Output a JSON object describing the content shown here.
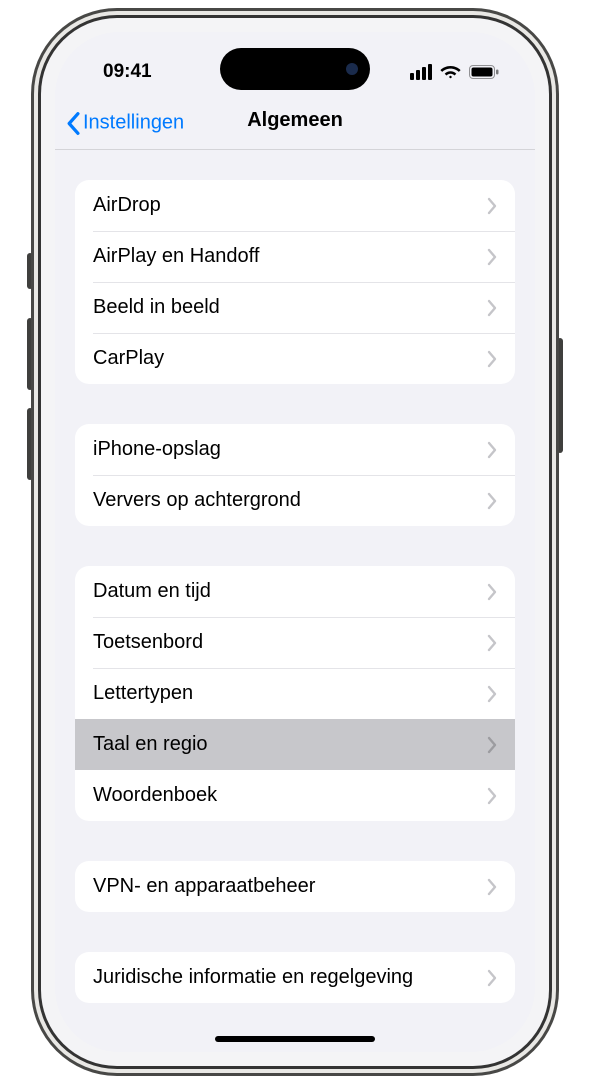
{
  "statusBar": {
    "time": "09:41"
  },
  "nav": {
    "back": "Instellingen",
    "title": "Algemeen"
  },
  "groups": [
    {
      "rows": [
        {
          "key": "airdrop",
          "label": "AirDrop"
        },
        {
          "key": "airplay-handoff",
          "label": "AirPlay en Handoff"
        },
        {
          "key": "picture-in-picture",
          "label": "Beeld in beeld"
        },
        {
          "key": "carplay",
          "label": "CarPlay"
        }
      ]
    },
    {
      "rows": [
        {
          "key": "iphone-storage",
          "label": "iPhone-opslag"
        },
        {
          "key": "background-refresh",
          "label": "Ververs op achtergrond"
        }
      ]
    },
    {
      "rows": [
        {
          "key": "date-time",
          "label": "Datum en tijd"
        },
        {
          "key": "keyboard",
          "label": "Toetsenbord"
        },
        {
          "key": "fonts",
          "label": "Lettertypen"
        },
        {
          "key": "language-region",
          "label": "Taal en regio",
          "highlight": true
        },
        {
          "key": "dictionary",
          "label": "Woordenboek"
        }
      ]
    },
    {
      "rows": [
        {
          "key": "vpn-device-management",
          "label": "VPN- en apparaatbeheer"
        }
      ]
    },
    {
      "rows": [
        {
          "key": "legal-regulatory",
          "label": "Juridische informatie en regelgeving"
        }
      ]
    }
  ]
}
